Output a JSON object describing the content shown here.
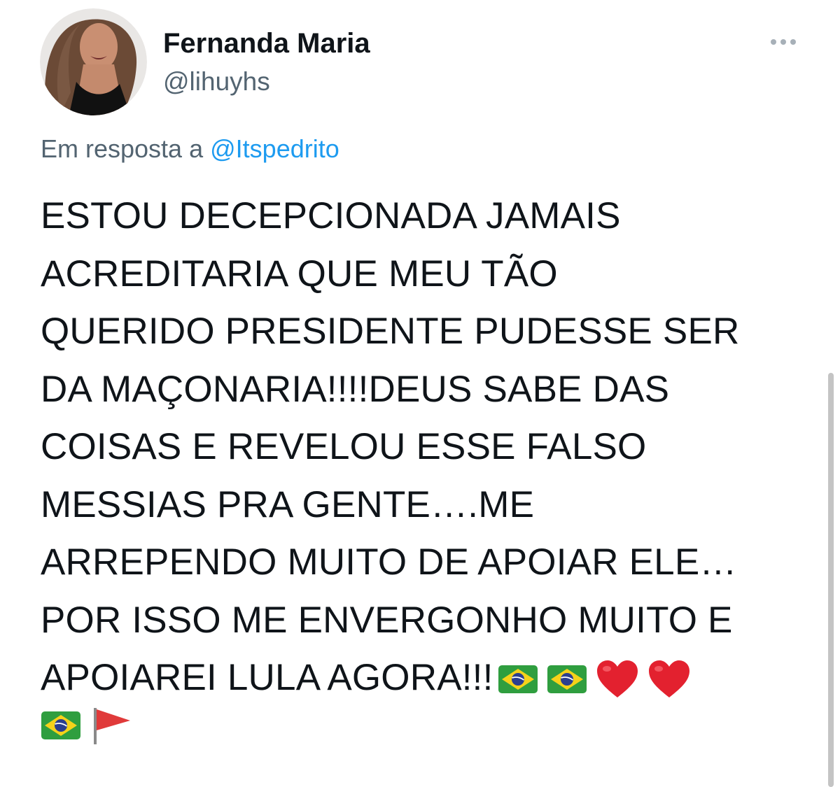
{
  "tweet": {
    "author": {
      "display_name": "Fernanda Maria",
      "handle": "@lihuyhs",
      "avatar_icon": "profile-photo"
    },
    "more_icon": "more-horizontal-icon",
    "reply": {
      "prefix": "Em resposta a",
      "mention": "@Itspedrito"
    },
    "text_lines": [
      "ESTOU DECEPCIONADA JAMAIS",
      "ACREDITARIA QUE MEU TÃO",
      "QUERIDO PRESIDENTE PUDESSE SER",
      "DA MAÇONARIA!!!!DEUS SABE DAS",
      "COISAS E REVELOU ESSE FALSO",
      "MESSIAS PRA GENTE….ME",
      "ARREPENDO MUITO DE APOIAR ELE…",
      "POR ISSO ME ENVERGONHO MUITO E",
      "APOIAREI LULA AGORA!!!"
    ],
    "trailing_emojis": [
      "brazil-flag-emoji",
      "brazil-flag-emoji",
      "red-heart-emoji",
      "red-heart-emoji"
    ],
    "last_line_emojis": [
      "brazil-flag-emoji",
      "triangular-flag-emoji"
    ]
  },
  "colors": {
    "text": "#0f1419",
    "secondary": "#536471",
    "link": "#1d9bf0"
  }
}
